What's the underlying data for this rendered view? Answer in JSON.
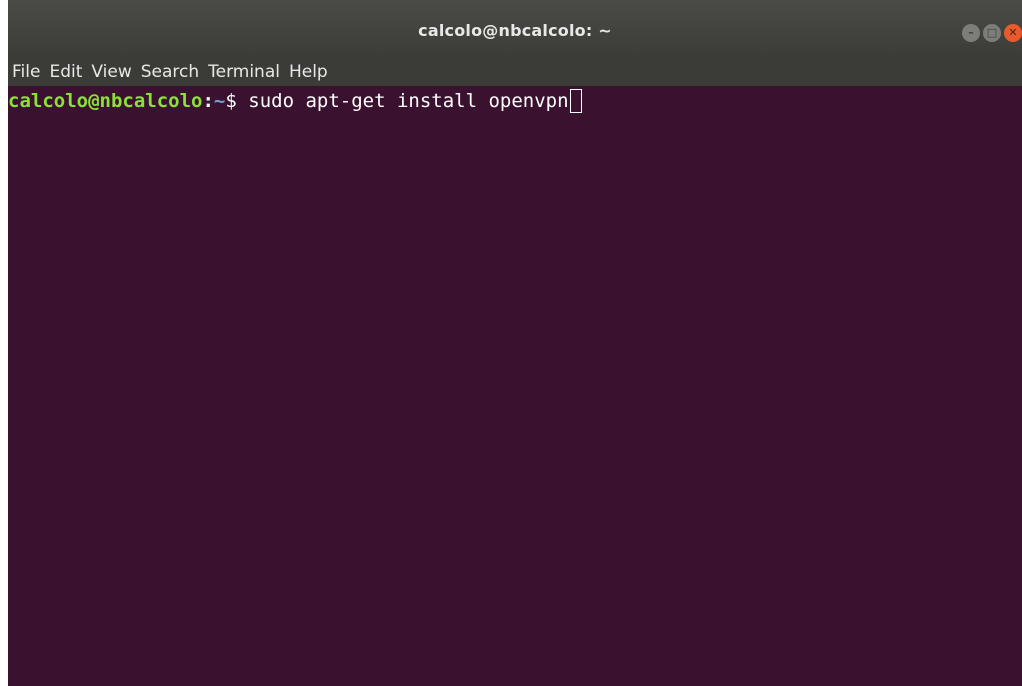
{
  "window": {
    "title": "calcolo@nbcalcolo: ~",
    "controls": {
      "minimize_icon": "minimize-icon",
      "maximize_icon": "maximize-icon",
      "close_icon": "close-icon"
    }
  },
  "menubar": {
    "items": [
      {
        "label": "File"
      },
      {
        "label": "Edit"
      },
      {
        "label": "View"
      },
      {
        "label": "Search"
      },
      {
        "label": "Terminal"
      },
      {
        "label": "Help"
      }
    ]
  },
  "terminal": {
    "prompt_user_host": "calcolo@nbcalcolo",
    "prompt_separator": ":",
    "prompt_path": "~",
    "prompt_symbol": "$ ",
    "command": "sudo apt-get install openvpn"
  },
  "colors": {
    "terminal_bg": "#3a1230",
    "prompt_user": "#8ae234",
    "prompt_path": "#729fcf",
    "titlebar": "#3b3b38",
    "close_button": "#e85a2c"
  }
}
